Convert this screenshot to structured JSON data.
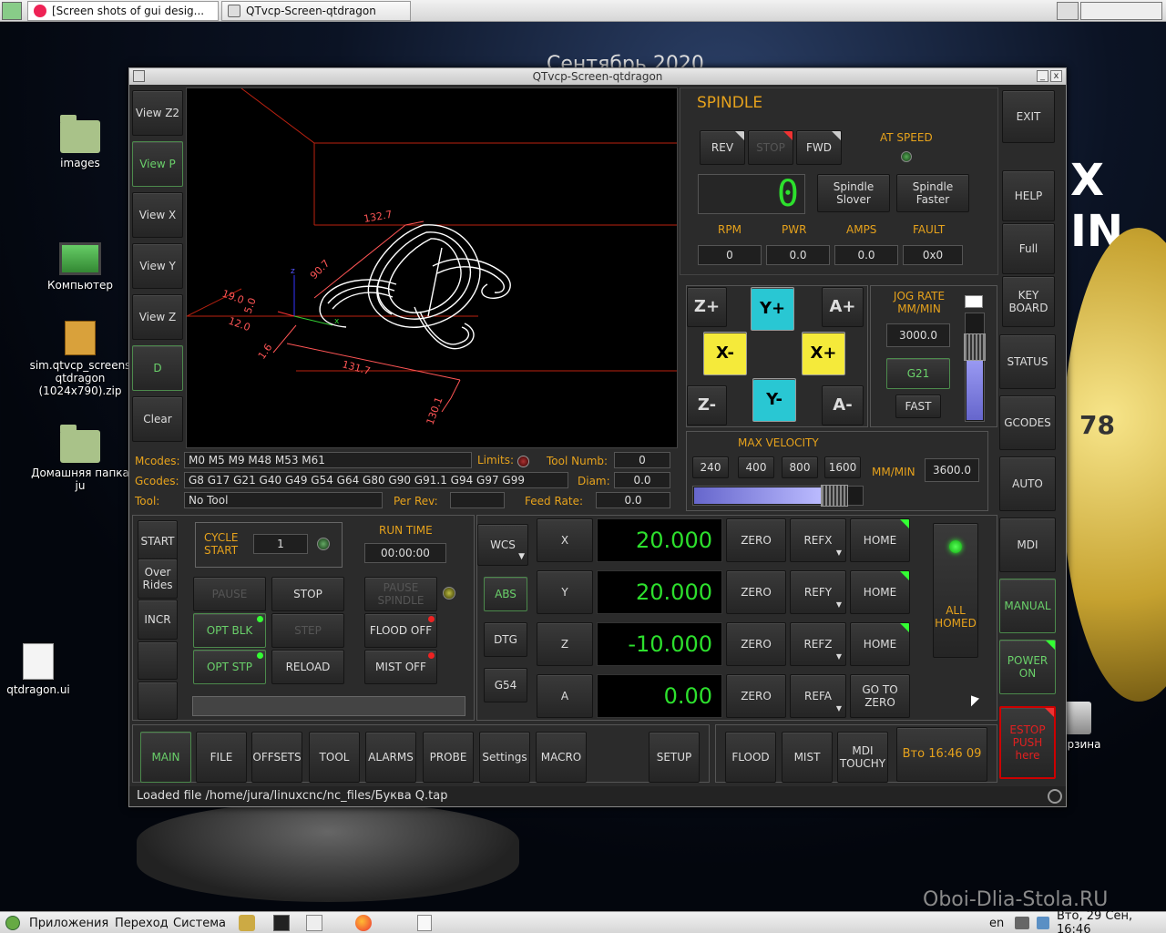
{
  "taskbar_top": {
    "tabs": [
      {
        "label": "[Screen shots of gui desig..."
      },
      {
        "label": "QTvcp-Screen-qtdragon"
      }
    ]
  },
  "wallpaper": {
    "date_text": "Сентябрь 2020",
    "brand_text": "X IN",
    "watermark": "Oboi-Dlia-Stola.RU",
    "badge_num": "78"
  },
  "desktop": {
    "icons": [
      {
        "label": "images"
      },
      {
        "label": "Компьютер"
      },
      {
        "label": "sim.qtvcp_screens qtdragon (1024x790).zip"
      },
      {
        "label": "Домашняя папка ju"
      },
      {
        "label": "qtdragon.ui"
      },
      {
        "label": "рзина"
      }
    ]
  },
  "window": {
    "title": "QTvcp-Screen-qtdragon",
    "min_label": "_",
    "close_label": "x"
  },
  "view_buttons": [
    "View Z2",
    "View P",
    "View X",
    "View Y",
    "View Z",
    "D",
    "Clear"
  ],
  "gcode_info": {
    "mcodes_label": "Mcodes:",
    "mcodes": "M0 M5 M9 M48 M53 M61",
    "limits_label": "Limits:",
    "toolnum_label": "Tool Numb:",
    "toolnum": "0",
    "gcodes_label": "Gcodes:",
    "gcodes": "G8 G17 G21 G40 G49 G54 G64 G80 G90 G91.1 G94 G97 G99",
    "diam_label": "Diam:",
    "diam": "0.0",
    "tool_label": "Tool:",
    "tool": "No Tool",
    "perrev_label": "Per Rev:",
    "perrev": "",
    "feedrate_label": "Feed Rate:",
    "feedrate": "0.0"
  },
  "preview": {
    "dims": [
      "132.7",
      "19.0",
      "12.0",
      "5.0",
      "1.6",
      "131.7",
      "130.1",
      "90.7"
    ]
  },
  "spindle": {
    "title": "SPINDLE",
    "rev": "REV",
    "stop": "STOP",
    "fwd": "FWD",
    "at_speed": "AT SPEED",
    "display": "0",
    "slower": "Spindle Slover",
    "faster": "Spindle Faster",
    "rpm_label": "RPM",
    "pwr_label": "PWR",
    "amps_label": "AMPS",
    "fault_label": "FAULT",
    "rpm": "0",
    "pwr": "0.0",
    "amps": "0.0",
    "fault": "0x0"
  },
  "jog": {
    "zp": "Z+",
    "yp": "Y+",
    "ap": "A+",
    "xm": "X-",
    "xp": "X+",
    "zm": "Z-",
    "ym": "Y-",
    "am": "A-",
    "rate_label": "JOG RATE MM/MIN",
    "rate": "3000.0",
    "units": "G21",
    "fast": "FAST",
    "rate_slider_level": 0.75
  },
  "max_velocity": {
    "label": "MAX VELOCITY",
    "presets": [
      "240",
      "400",
      "800",
      "1600"
    ],
    "units": "MM/MIN",
    "value": "3600.0",
    "slider_level": 0.9
  },
  "right_buttons": [
    "EXIT",
    "HELP",
    "Full",
    "KEY BOARD",
    "STATUS",
    "GCODES",
    "AUTO",
    "MDI",
    "MANUAL",
    "POWER ON",
    "ESTOP PUSH here"
  ],
  "program": {
    "start": "START",
    "overrides": "Over Rides",
    "incr": "INCR",
    "cycle_start": "CYCLE START",
    "cycle_count": "1",
    "run_time_label": "RUN TIME",
    "run_time": "00:00:00",
    "pause": "PAUSE",
    "stop": "STOP",
    "pause_spindle": "PAUSE SPINDLE",
    "opt_blk": "OPT BLK",
    "step": "STEP",
    "flood_off": "FLOOD OFF",
    "opt_stp": "OPT STP",
    "reload": "RELOAD",
    "mist_off": "MIST OFF"
  },
  "dro": {
    "modes": [
      "WCS",
      "ABS",
      "DTG",
      "G54"
    ],
    "axes": [
      {
        "name": "X",
        "value": "20.000",
        "ref": "REFX",
        "home": "HOME"
      },
      {
        "name": "Y",
        "value": "20.000",
        "ref": "REFY",
        "home": "HOME"
      },
      {
        "name": "Z",
        "value": "-10.000",
        "ref": "REFZ",
        "home": "HOME"
      },
      {
        "name": "A",
        "value": "0.00",
        "ref": "REFA",
        "home": "GO TO ZERO"
      }
    ],
    "zero": "ZERO",
    "all_homed": "ALL HOMED"
  },
  "bottom_tabs": [
    "MAIN",
    "FILE",
    "OFFSETS",
    "TOOL",
    "ALARMS",
    "PROBE",
    "Settings",
    "MACRO",
    "SETUP"
  ],
  "bottom_right": {
    "flood": "FLOOD",
    "mist": "MIST",
    "mdi_touchy": "MDI TOUCHY",
    "clock": "Вто 16:46 09"
  },
  "status_text": "Loaded file /home/jura/linuxcnc/nc_files/Буква Q.tap",
  "taskbar_bottom": {
    "apps": "Приложения",
    "places": "Переход",
    "system": "Система",
    "lang": "en",
    "clock": "Вто, 29 Сен, 16:46"
  },
  "colors": {
    "accent_orange": "#e6a21c",
    "dro_green": "#2de02d",
    "jog_yellow": "#f5ea3a",
    "jog_cyan": "#29c7d3",
    "led_green": "#3f3",
    "estop_red": "#e02020"
  }
}
